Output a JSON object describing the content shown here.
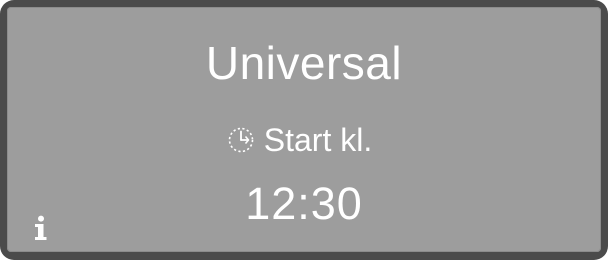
{
  "display": {
    "program_name": "Universal",
    "start_label": "Start kl.",
    "start_time": "12:30"
  },
  "icons": {
    "start_icon": "clock-timer-icon",
    "info_icon": "info-icon"
  },
  "colors": {
    "frame": "#4b4b4b",
    "screen": "#9d9d9d",
    "text": "#ffffff"
  }
}
